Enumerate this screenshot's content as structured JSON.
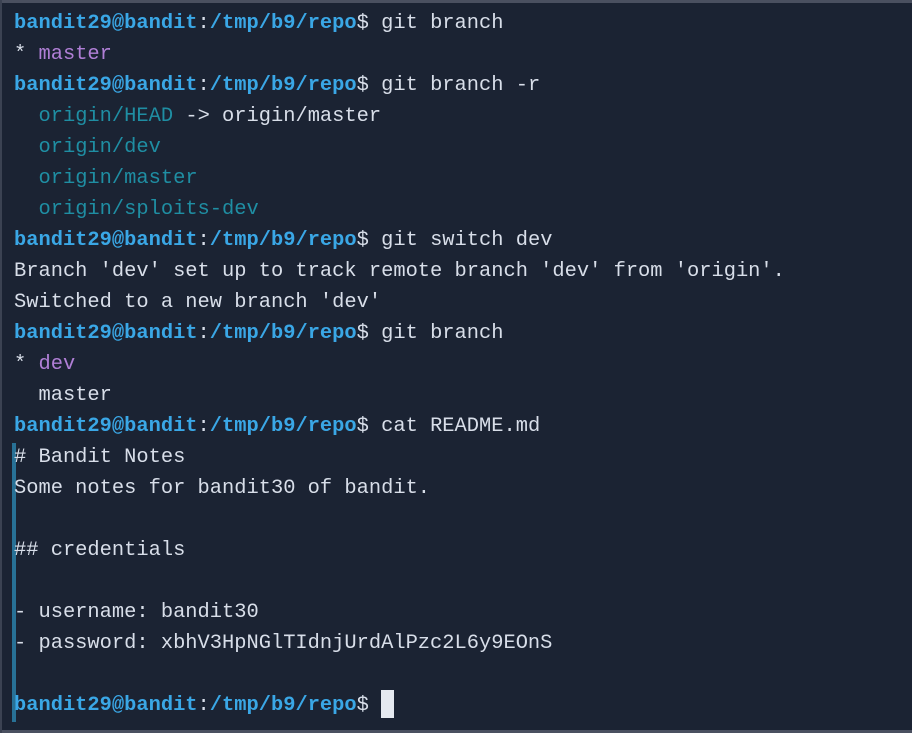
{
  "prompt": {
    "user": "bandit29@bandit",
    "path": "/tmp/b9/repo",
    "symbol": "$ "
  },
  "lines": [
    {
      "type": "cmd",
      "command": "git branch"
    },
    {
      "type": "out",
      "prefix": "* ",
      "text": "master",
      "style": "purple"
    },
    {
      "type": "cmd",
      "command": "git branch -r"
    },
    {
      "type": "out",
      "prefix": "  ",
      "text": "origin/HEAD",
      "style": "teal",
      "suffix": " -> origin/master"
    },
    {
      "type": "out",
      "prefix": "  ",
      "text": "origin/dev",
      "style": "teal"
    },
    {
      "type": "out",
      "prefix": "  ",
      "text": "origin/master",
      "style": "teal"
    },
    {
      "type": "out",
      "prefix": "  ",
      "text": "origin/sploits-dev",
      "style": "teal"
    },
    {
      "type": "cmd",
      "command": "git switch dev"
    },
    {
      "type": "out",
      "prefix": "",
      "text": "Branch 'dev' set up to track remote branch 'dev' from 'origin'.",
      "style": "plain"
    },
    {
      "type": "out",
      "prefix": "",
      "text": "Switched to a new branch 'dev'",
      "style": "plain"
    },
    {
      "type": "cmd",
      "command": "git branch"
    },
    {
      "type": "out",
      "prefix": "* ",
      "text": "dev",
      "style": "purple"
    },
    {
      "type": "out",
      "prefix": "  ",
      "text": "master",
      "style": "plain"
    },
    {
      "type": "cmd",
      "command": "cat README.md"
    },
    {
      "type": "out",
      "prefix": "",
      "text": "# Bandit Notes",
      "style": "plain"
    },
    {
      "type": "out",
      "prefix": "",
      "text": "Some notes for bandit30 of bandit.",
      "style": "plain"
    },
    {
      "type": "out",
      "prefix": "",
      "text": "",
      "style": "plain"
    },
    {
      "type": "out",
      "prefix": "",
      "text": "## credentials",
      "style": "plain"
    },
    {
      "type": "out",
      "prefix": "",
      "text": "",
      "style": "plain"
    },
    {
      "type": "out",
      "prefix": "",
      "text": "- username: bandit30",
      "style": "plain"
    },
    {
      "type": "out",
      "prefix": "",
      "text": "- password: xbhV3HpNGlTIdnjUrdAlPzc2L6y9EOnS",
      "style": "plain"
    },
    {
      "type": "out",
      "prefix": "",
      "text": "",
      "style": "plain"
    },
    {
      "type": "prompt-cursor",
      "command": ""
    }
  ]
}
